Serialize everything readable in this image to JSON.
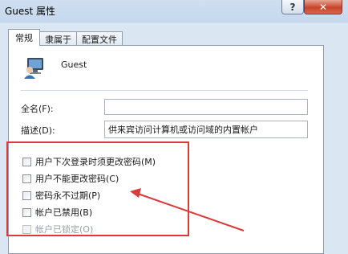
{
  "window": {
    "title": "Guest 属性",
    "help_label": "?",
    "close_label": "✕"
  },
  "tabs": [
    {
      "label": "常规",
      "active": true
    },
    {
      "label": "隶属于",
      "active": false
    },
    {
      "label": "配置文件",
      "active": false
    }
  ],
  "user": {
    "name": "Guest",
    "icon": "user-account-icon"
  },
  "fields": {
    "fullname_label": "全名(F):",
    "fullname_value": "",
    "description_label": "描述(D):",
    "description_value": "供来宾访问计算机或访问域的内置帐户"
  },
  "options": [
    {
      "label": "用户下次登录时须更改密码(M)",
      "checked": false,
      "enabled": true
    },
    {
      "label": "用户不能更改密码(C)",
      "checked": false,
      "enabled": true
    },
    {
      "label": "密码永不过期(P)",
      "checked": false,
      "enabled": true
    },
    {
      "label": "帐户已禁用(B)",
      "checked": false,
      "enabled": true
    },
    {
      "label": "帐户已锁定(O)",
      "checked": false,
      "enabled": false
    }
  ],
  "colors": {
    "annotation": "#d93a3a"
  }
}
